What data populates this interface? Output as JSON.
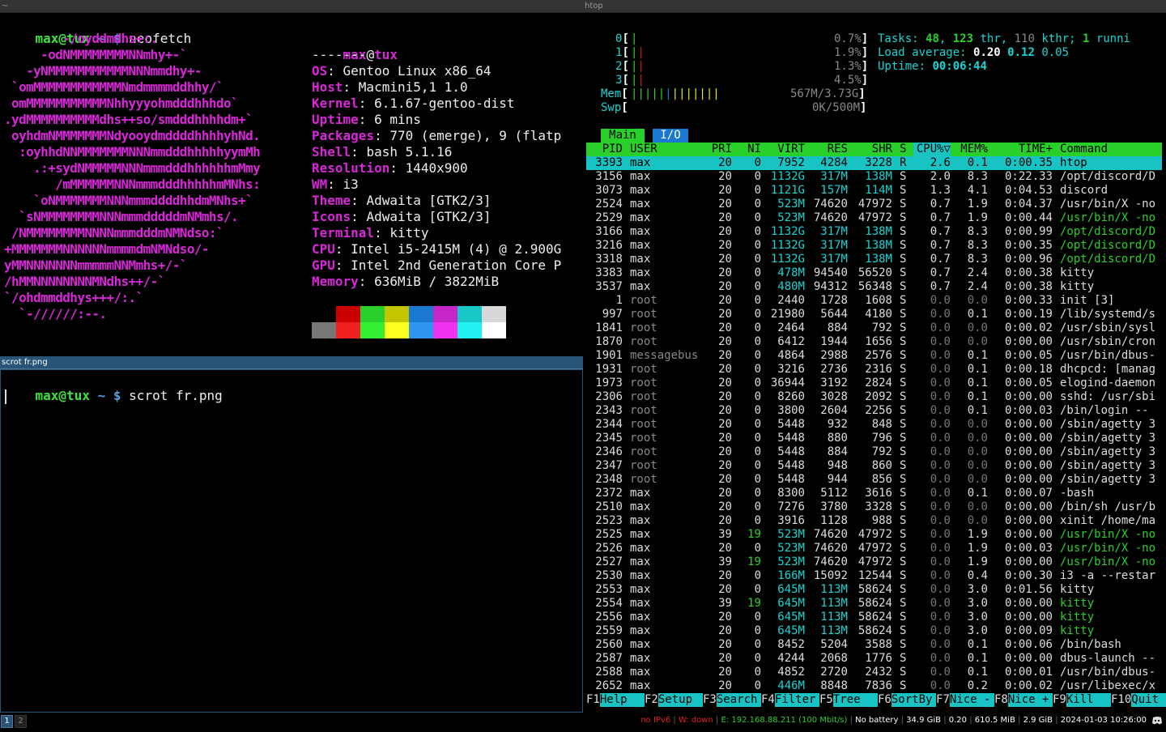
{
  "desktop": {
    "left_top_title": "~",
    "right_title": "htop",
    "left_bottom_title": "scrot fr.png"
  },
  "neofetch": {
    "prompt_user": "max@tux",
    "prompt_path": "~",
    "prompt_sym": "$",
    "command": "neofetch",
    "user": "max",
    "host": "tux",
    "sep": "-------",
    "logo": [
      "        -/oyddmdhs+:.",
      "     -odNMMMMMMMMNNmhy+-`",
      "   -yNMMMMMMMMMMMNNNmmdhy+-",
      " `omMMMMMMMMMMMMNmdmmmmddhhy/`",
      " omMMMMMMMMMMMNhhyyyohmdddhhhdo`",
      ".ydMMMMMMMMMMdhs++so/smdddhhhhdm+`",
      " oyhdmNMMMMMMMNdyooydmddddhhhhyhNd.",
      "  :oyhhdNNMMMMMMMNNNmmdddhhhhhyymMh",
      "    .:+sydNMMMMMNNNmmmdddhhhhhhmMmy",
      "       /mMMMMMMNNNmmmdddhhhhhmMNhs:",
      "    `oNMMMMMMMNNNmmmddddhhdmMNhs+`",
      "  `sNMMMMMMMMNNNmmmdddddmNMmhs/.",
      " /NMMMMMMMMNNNNmmmdddmNMNdso:`",
      "+MMMMMMMNNNNNNmmmmdmNMNdso/-",
      "yMMNNNNNNNmmmmmNNMmhs+/-`",
      "/hMMNNNNNNNNMNdhs++/-`",
      "`/ohdmmddhys+++/:.`",
      "  `-//////:--."
    ],
    "info": [
      {
        "key": "OS",
        "value": "Gentoo Linux x86_64"
      },
      {
        "key": "Host",
        "value": "Macmini5,1 1.0"
      },
      {
        "key": "Kernel",
        "value": "6.1.67-gentoo-dist"
      },
      {
        "key": "Uptime",
        "value": "6 mins"
      },
      {
        "key": "Packages",
        "value": "770 (emerge), 9 (flatp"
      },
      {
        "key": "Shell",
        "value": "bash 5.1.16"
      },
      {
        "key": "Resolution",
        "value": "1440x900"
      },
      {
        "key": "WM",
        "value": "i3"
      },
      {
        "key": "Theme",
        "value": "Adwaita [GTK2/3]"
      },
      {
        "key": "Icons",
        "value": "Adwaita [GTK2/3]"
      },
      {
        "key": "Terminal",
        "value": "kitty"
      },
      {
        "key": "CPU",
        "value": "Intel i5-2415M (4) @ 2.900G"
      },
      {
        "key": "GPU",
        "value": "Intel 2nd Generation Core P"
      },
      {
        "key": "Memory",
        "value": "636MiB / 3822MiB"
      }
    ],
    "colors_top": [
      "#000000",
      "#cc0000",
      "#2ad02a",
      "#c4c400",
      "#1b78d0",
      "#c526c5",
      "#18c8c8",
      "#d8d8d8"
    ],
    "colors_bottom": [
      "#777777",
      "#ee2020",
      "#33ee33",
      "#ffff20",
      "#2e95f0",
      "#f033f0",
      "#20f0f0",
      "#ffffff"
    ]
  },
  "scrot": {
    "prompt_user": "max@tux",
    "prompt_path": "~",
    "prompt_sym": "$",
    "command": "scrot fr.png"
  },
  "htop": {
    "cpus": [
      {
        "label": "0",
        "bars": "|",
        "pct": "0.7%"
      },
      {
        "label": "1",
        "bars": "||",
        "pct": "1.9%"
      },
      {
        "label": "2",
        "bars": "||",
        "pct": "1.3%"
      },
      {
        "label": "3",
        "bars": "||",
        "pct": "4.5%"
      }
    ],
    "mem": {
      "label": "Mem",
      "bars": "|||||||||||||",
      "value": "567M/3.73G"
    },
    "swp": {
      "label": "Swp",
      "bars": "",
      "value": "0K/500M"
    },
    "tasks": {
      "label": "Tasks:",
      "tasks": "48",
      "thr": "123",
      "thr_label": "thr,",
      "kthr": "110",
      "kthr_label": "kthr;",
      "running": "1",
      "running_label": "runni"
    },
    "load": {
      "label": "Load average:",
      "l1": "0.20",
      "l5": "0.12",
      "l15": "0.05"
    },
    "uptime": {
      "label": "Uptime:",
      "value": "00:06:44"
    },
    "tabs": [
      "Main",
      "I/O"
    ],
    "columns": [
      "PID",
      "USER",
      "PRI",
      "NI",
      "VIRT",
      "RES",
      "SHR",
      "S",
      "CPU%▽",
      "MEM%",
      "TIME+",
      "Command"
    ],
    "processes": [
      [
        "3393",
        "max",
        "20",
        "0",
        "7952",
        "4284",
        "3228",
        "R",
        "2.6",
        "0.1",
        "0:00.35",
        "htop"
      ],
      [
        "3156",
        "max",
        "20",
        "0",
        "1132G",
        "317M",
        "138M",
        "S",
        "2.0",
        "8.3",
        "0:22.33",
        "/opt/discord/D"
      ],
      [
        "3073",
        "max",
        "20",
        "0",
        "1121G",
        "157M",
        "114M",
        "S",
        "1.3",
        "4.1",
        "0:04.53",
        "discord"
      ],
      [
        "2524",
        "max",
        "20",
        "0",
        "523M",
        "74620",
        "47972",
        "S",
        "0.7",
        "1.9",
        "0:04.37",
        "/usr/bin/X -no"
      ],
      [
        "2529",
        "max",
        "20",
        "0",
        "523M",
        "74620",
        "47972",
        "S",
        "0.7",
        "1.9",
        "0:00.44",
        "/usr/bin/X -no"
      ],
      [
        "3166",
        "max",
        "20",
        "0",
        "1132G",
        "317M",
        "138M",
        "S",
        "0.7",
        "8.3",
        "0:00.99",
        "/opt/discord/D"
      ],
      [
        "3216",
        "max",
        "20",
        "0",
        "1132G",
        "317M",
        "138M",
        "S",
        "0.7",
        "8.3",
        "0:00.35",
        "/opt/discord/D"
      ],
      [
        "3318",
        "max",
        "20",
        "0",
        "1132G",
        "317M",
        "138M",
        "S",
        "0.7",
        "8.3",
        "0:00.96",
        "/opt/discord/D"
      ],
      [
        "3383",
        "max",
        "20",
        "0",
        "478M",
        "94540",
        "56520",
        "S",
        "0.7",
        "2.4",
        "0:00.38",
        "kitty"
      ],
      [
        "3537",
        "max",
        "20",
        "0",
        "480M",
        "94312",
        "56348",
        "S",
        "0.7",
        "2.4",
        "0:00.38",
        "kitty"
      ],
      [
        "1",
        "root",
        "20",
        "0",
        "2440",
        "1728",
        "1608",
        "S",
        "0.0",
        "0.0",
        "0:00.33",
        "init [3]"
      ],
      [
        "997",
        "root",
        "20",
        "0",
        "21980",
        "5644",
        "4180",
        "S",
        "0.0",
        "0.1",
        "0:00.19",
        "/lib/systemd/s"
      ],
      [
        "1841",
        "root",
        "20",
        "0",
        "2464",
        "884",
        "792",
        "S",
        "0.0",
        "0.0",
        "0:00.02",
        "/usr/sbin/sysl"
      ],
      [
        "1870",
        "root",
        "20",
        "0",
        "6412",
        "1944",
        "1656",
        "S",
        "0.0",
        "0.0",
        "0:00.00",
        "/usr/sbin/cron"
      ],
      [
        "1901",
        "messagebus",
        "20",
        "0",
        "4864",
        "2988",
        "2576",
        "S",
        "0.0",
        "0.1",
        "0:00.05",
        "/usr/bin/dbus-"
      ],
      [
        "1931",
        "root",
        "20",
        "0",
        "3216",
        "2736",
        "2316",
        "S",
        "0.0",
        "0.1",
        "0:00.18",
        "dhcpcd: [manag"
      ],
      [
        "1973",
        "root",
        "20",
        "0",
        "36944",
        "3192",
        "2824",
        "S",
        "0.0",
        "0.1",
        "0:00.05",
        "elogind-daemon"
      ],
      [
        "2306",
        "root",
        "20",
        "0",
        "8260",
        "3028",
        "2092",
        "S",
        "0.0",
        "0.1",
        "0:00.00",
        "sshd: /usr/sbi"
      ],
      [
        "2343",
        "root",
        "20",
        "0",
        "3800",
        "2604",
        "2256",
        "S",
        "0.0",
        "0.1",
        "0:00.03",
        "/bin/login --"
      ],
      [
        "2344",
        "root",
        "20",
        "0",
        "5448",
        "932",
        "848",
        "S",
        "0.0",
        "0.0",
        "0:00.00",
        "/sbin/agetty 3"
      ],
      [
        "2345",
        "root",
        "20",
        "0",
        "5448",
        "880",
        "796",
        "S",
        "0.0",
        "0.0",
        "0:00.00",
        "/sbin/agetty 3"
      ],
      [
        "2346",
        "root",
        "20",
        "0",
        "5448",
        "884",
        "792",
        "S",
        "0.0",
        "0.0",
        "0:00.00",
        "/sbin/agetty 3"
      ],
      [
        "2347",
        "root",
        "20",
        "0",
        "5448",
        "948",
        "860",
        "S",
        "0.0",
        "0.0",
        "0:00.00",
        "/sbin/agetty 3"
      ],
      [
        "2348",
        "root",
        "20",
        "0",
        "5448",
        "944",
        "856",
        "S",
        "0.0",
        "0.0",
        "0:00.00",
        "/sbin/agetty 3"
      ],
      [
        "2372",
        "max",
        "20",
        "0",
        "8300",
        "5112",
        "3616",
        "S",
        "0.0",
        "0.1",
        "0:00.07",
        "-bash"
      ],
      [
        "2510",
        "max",
        "20",
        "0",
        "7276",
        "3780",
        "3328",
        "S",
        "0.0",
        "0.0",
        "0:00.00",
        "/bin/sh /usr/b"
      ],
      [
        "2523",
        "max",
        "20",
        "0",
        "3916",
        "1128",
        "988",
        "S",
        "0.0",
        "0.0",
        "0:00.00",
        "xinit /home/ma"
      ],
      [
        "2525",
        "max",
        "39",
        "19",
        "523M",
        "74620",
        "47972",
        "S",
        "0.0",
        "1.9",
        "0:00.00",
        "/usr/bin/X -no"
      ],
      [
        "2526",
        "max",
        "20",
        "0",
        "523M",
        "74620",
        "47972",
        "S",
        "0.0",
        "1.9",
        "0:00.03",
        "/usr/bin/X -no"
      ],
      [
        "2527",
        "max",
        "39",
        "19",
        "523M",
        "74620",
        "47972",
        "S",
        "0.0",
        "1.9",
        "0:00.00",
        "/usr/bin/X -no"
      ],
      [
        "2530",
        "max",
        "20",
        "0",
        "166M",
        "15092",
        "12544",
        "S",
        "0.0",
        "0.4",
        "0:00.30",
        "i3 -a --restar"
      ],
      [
        "2553",
        "max",
        "20",
        "0",
        "645M",
        "113M",
        "58624",
        "S",
        "0.0",
        "3.0",
        "0:01.56",
        "kitty"
      ],
      [
        "2554",
        "max",
        "39",
        "19",
        "645M",
        "113M",
        "58624",
        "S",
        "0.0",
        "3.0",
        "0:00.00",
        "kitty"
      ],
      [
        "2556",
        "max",
        "20",
        "0",
        "645M",
        "113M",
        "58624",
        "S",
        "0.0",
        "3.0",
        "0:00.00",
        "kitty"
      ],
      [
        "2559",
        "max",
        "20",
        "0",
        "645M",
        "113M",
        "58624",
        "S",
        "0.0",
        "3.0",
        "0:00.09",
        "kitty"
      ],
      [
        "2560",
        "max",
        "20",
        "0",
        "8452",
        "5204",
        "3588",
        "S",
        "0.0",
        "0.1",
        "0:00.06",
        "/bin/bash"
      ],
      [
        "2587",
        "max",
        "20",
        "0",
        "4244",
        "2068",
        "1776",
        "S",
        "0.0",
        "0.1",
        "0:00.00",
        "dbus-launch --"
      ],
      [
        "2588",
        "max",
        "20",
        "0",
        "4852",
        "2720",
        "2432",
        "S",
        "0.0",
        "0.1",
        "0:00.01",
        "/usr/bin/dbus-"
      ],
      [
        "2652",
        "max",
        "20",
        "0",
        "446M",
        "8848",
        "7836",
        "S",
        "0.0",
        "0.2",
        "0:00.02",
        "/usr/libexec/x"
      ]
    ],
    "green_cmd_rows": [
      4,
      5,
      6,
      7,
      27,
      28,
      29,
      32,
      33,
      34
    ],
    "fkeys": [
      {
        "key": "F1",
        "label": "Help"
      },
      {
        "key": "F2",
        "label": "Setup"
      },
      {
        "key": "F3",
        "label": "Search"
      },
      {
        "key": "F4",
        "label": "Filter"
      },
      {
        "key": "F5",
        "label": "Tree"
      },
      {
        "key": "F6",
        "label": "SortBy"
      },
      {
        "key": "F7",
        "label": "Nice -"
      },
      {
        "key": "F8",
        "label": "Nice +"
      },
      {
        "key": "F9",
        "label": "Kill"
      },
      {
        "key": "F10",
        "label": "Quit"
      }
    ]
  },
  "i3bar": {
    "workspaces": [
      "1",
      "2"
    ],
    "status": [
      {
        "text": "no IPv6",
        "color": "#e02020"
      },
      {
        "text": "W: down",
        "color": "#e02020"
      },
      {
        "text": "E: 192.168.88.211 (100 Mbit/s)",
        "color": "#2ad02a"
      },
      {
        "text": "No battery",
        "color": "#ffffff"
      },
      {
        "text": "34.9 GiB",
        "color": "#ffffff"
      },
      {
        "text": "0.20",
        "color": "#ffffff"
      },
      {
        "text": "610.5 MiB",
        "color": "#ffffff"
      },
      {
        "text": "2.9 GiB",
        "color": "#ffffff"
      },
      {
        "text": "2024-01-03 10:26:00",
        "color": "#ffffff"
      }
    ],
    "tray_icon": "discord-tray-icon"
  }
}
